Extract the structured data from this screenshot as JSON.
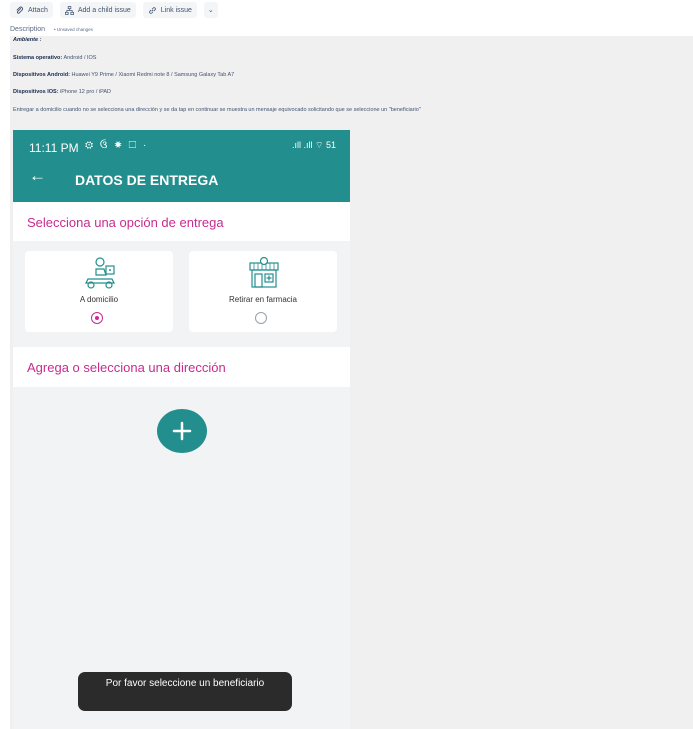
{
  "toolbar": {
    "attach_label": "Attach",
    "child_issue_label": "Add a child issue",
    "link_issue_label": "Link issue",
    "more_label": "⌄"
  },
  "description": {
    "label": "Description",
    "unsaved": "• Unsaved changes",
    "heading": "Ambiente :",
    "lines": [
      {
        "key": "Sistema operativo:",
        "value": "Android / IOS"
      },
      {
        "key": "Dispositivos Android:",
        "value": "Huawei Y9 Prime / Xiaomi Redmi note 8 / Samsung Galaxy Tab A7"
      },
      {
        "key": "Dispositivos IOS:",
        "value": "iPhone 12 pro / iPAD"
      }
    ],
    "body": "Entregar a domicilio cuando no se selecciona una dirección y se da tap en continuar se muestra un mensaje equivocado solicitando que se seleccione un \"beneficiario\""
  },
  "phone": {
    "status_time": "11:11 PM",
    "status_icons": "⚙ ઉ ✸ ☐ ·",
    "status_right": ".ıll .ıll ⌔ 51",
    "back_icon": "arrow-left",
    "title": "DATOS DE ENTREGA",
    "delivery_heading": "Selecciona una opción de entrega",
    "options": [
      {
        "label": "A domicilio",
        "selected": true,
        "icon": "delivery-scooter-icon"
      },
      {
        "label": "Retirar en farmacia",
        "selected": false,
        "icon": "pharmacy-store-icon"
      }
    ],
    "address_heading": "Agrega o selecciona una dirección",
    "add_icon": "plus-icon",
    "toast": "Por favor seleccione un beneficiario",
    "colors": {
      "teal": "#238e8e",
      "magenta": "#c72c8f"
    }
  }
}
